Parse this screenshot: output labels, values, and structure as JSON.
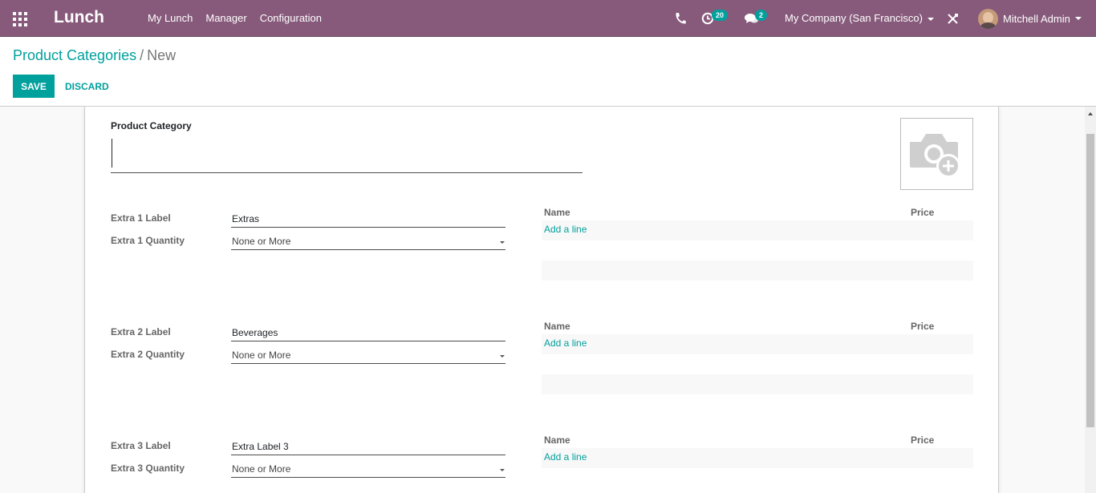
{
  "navbar": {
    "apps_icon": "grid-icon",
    "brand": "Lunch",
    "menu": [
      "My Lunch",
      "Manager",
      "Configuration"
    ],
    "activity_badge": "20",
    "chat_badge": "2",
    "company": "My Company (San Francisco)",
    "user_name": "Mitchell Admin",
    "accent": "#875a7b"
  },
  "breadcrumb": {
    "parent": "Product Categories",
    "separator": "/",
    "current": "New"
  },
  "buttons": {
    "save": "SAVE",
    "discard": "DISCARD"
  },
  "form": {
    "product_category_label": "Product Category",
    "product_category_value": "",
    "extras": [
      {
        "label_caption": "Extra 1 Label",
        "label_value": "Extras",
        "quantity_caption": "Extra 1 Quantity",
        "quantity_value": "None or More",
        "col_name": "Name",
        "col_price": "Price",
        "add_line": "Add a line"
      },
      {
        "label_caption": "Extra 2 Label",
        "label_value": "Beverages",
        "quantity_caption": "Extra 2 Quantity",
        "quantity_value": "None or More",
        "col_name": "Name",
        "col_price": "Price",
        "add_line": "Add a line"
      },
      {
        "label_caption": "Extra 3 Label",
        "label_value": "Extra Label 3",
        "quantity_caption": "Extra 3 Quantity",
        "quantity_value": "None or More",
        "col_name": "Name",
        "col_price": "Price",
        "add_line": "Add a line"
      }
    ]
  },
  "colors": {
    "primary": "#00a09d",
    "navbar": "#875a7b"
  }
}
